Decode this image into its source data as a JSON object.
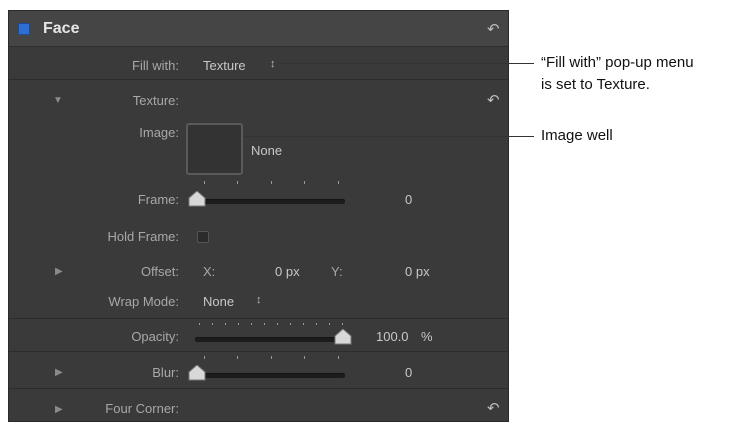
{
  "header": {
    "title": "Face",
    "reset_icon": "reset-arrow-icon"
  },
  "rows": {
    "fill_with": {
      "label": "Fill with:",
      "value": "Texture"
    },
    "texture": {
      "label": "Texture:"
    },
    "image": {
      "label": "Image:",
      "value": "None"
    },
    "frame": {
      "label": "Frame:",
      "value": "0"
    },
    "hold_frame": {
      "label": "Hold Frame:"
    },
    "offset": {
      "label": "Offset:",
      "x_label": "X:",
      "x_value": "0 px",
      "y_label": "Y:",
      "y_value": "0 px"
    },
    "wrap_mode": {
      "label": "Wrap Mode:",
      "value": "None"
    },
    "opacity": {
      "label": "Opacity:",
      "value": "100.0",
      "unit": "%",
      "level": 1.0
    },
    "blur": {
      "label": "Blur:",
      "value": "0",
      "level": 0
    },
    "four_corner": {
      "label": "Four Corner:"
    }
  },
  "callouts": {
    "fill_with_line1": "“Fill with” pop-up menu",
    "fill_with_line2": "is set to Texture.",
    "image_well": "Image well"
  },
  "colors": {
    "panel_bg": "#3a3a3a",
    "enable_blue": "#2f6fd4"
  }
}
